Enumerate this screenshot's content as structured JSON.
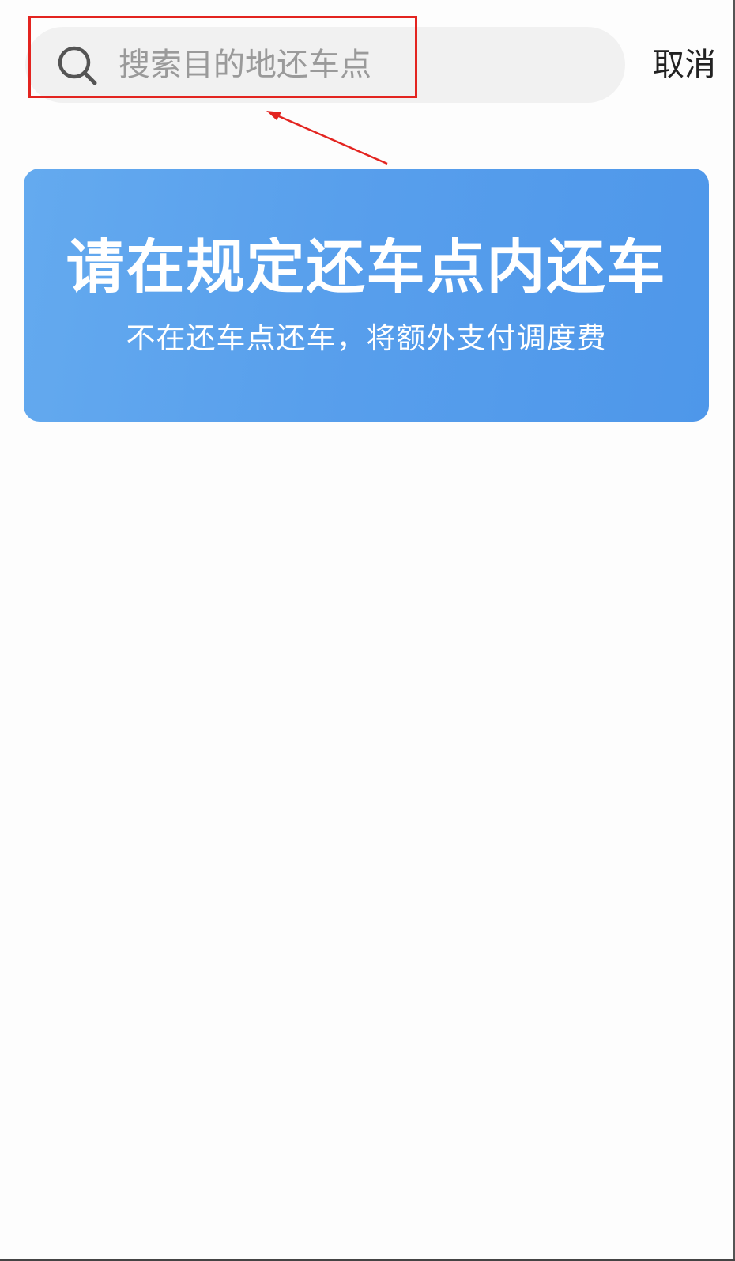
{
  "search": {
    "placeholder": "搜索目的地还车点",
    "value": "",
    "icon": "search-icon"
  },
  "header": {
    "cancel_label": "取消"
  },
  "banner": {
    "title": "请在规定还车点内还车",
    "subtitle": "不在还车点还车，将额外支付调度费",
    "gradient_colors": [
      "#64aaef",
      "#4e97ea"
    ]
  },
  "annotation": {
    "highlight_color": "#e32420"
  }
}
